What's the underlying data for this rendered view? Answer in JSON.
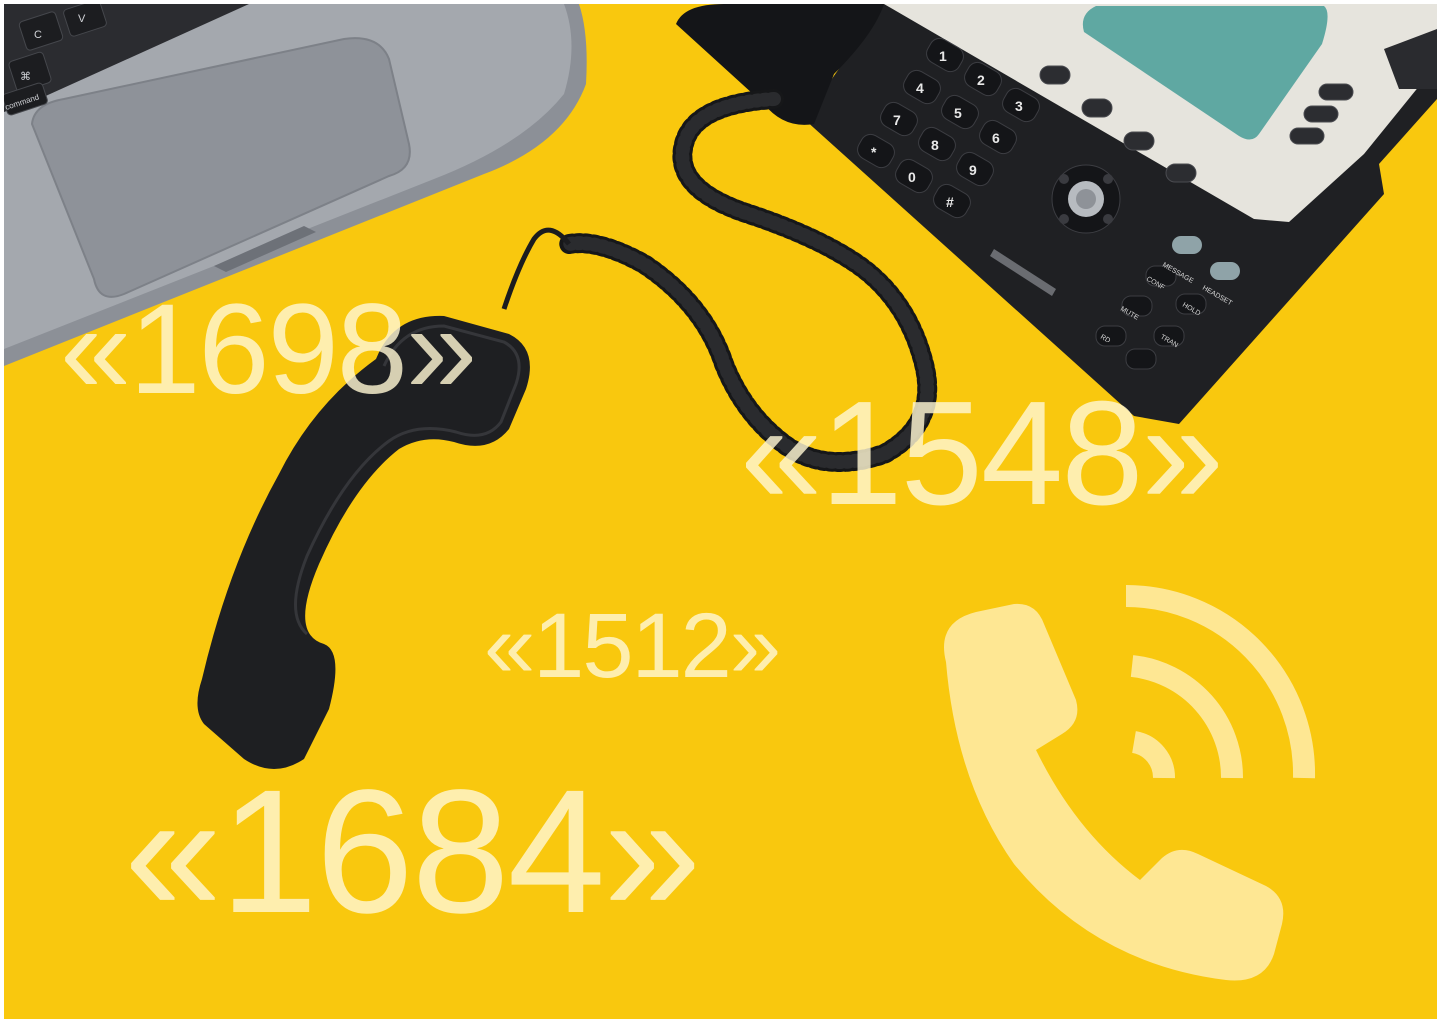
{
  "overlay_numbers": {
    "top_left": "«1698»",
    "right": "«1548»",
    "center": "«1512»",
    "bottom_left": "«1684»"
  },
  "laptop": {
    "keys": [
      "C",
      "V",
      "⌘",
      "command"
    ]
  },
  "desk_phone": {
    "keypad": [
      "1",
      "2",
      "3",
      "4",
      "5",
      "6",
      "7",
      "8",
      "9",
      "*",
      "0",
      "#"
    ],
    "function_keys": [
      "MESSAGE",
      "HEADSET",
      "CONF",
      "HOLD",
      "MUTE",
      "TRAN",
      "RD"
    ]
  },
  "icons": {
    "overlay_icon": "phone-calling-icon"
  },
  "colors": {
    "background": "#f9c80e",
    "overlay_text": "#fff7d2",
    "device_dark": "#1e1f22",
    "laptop_body": "#9a9ea5",
    "phone_screen": "#5fa8a2"
  }
}
